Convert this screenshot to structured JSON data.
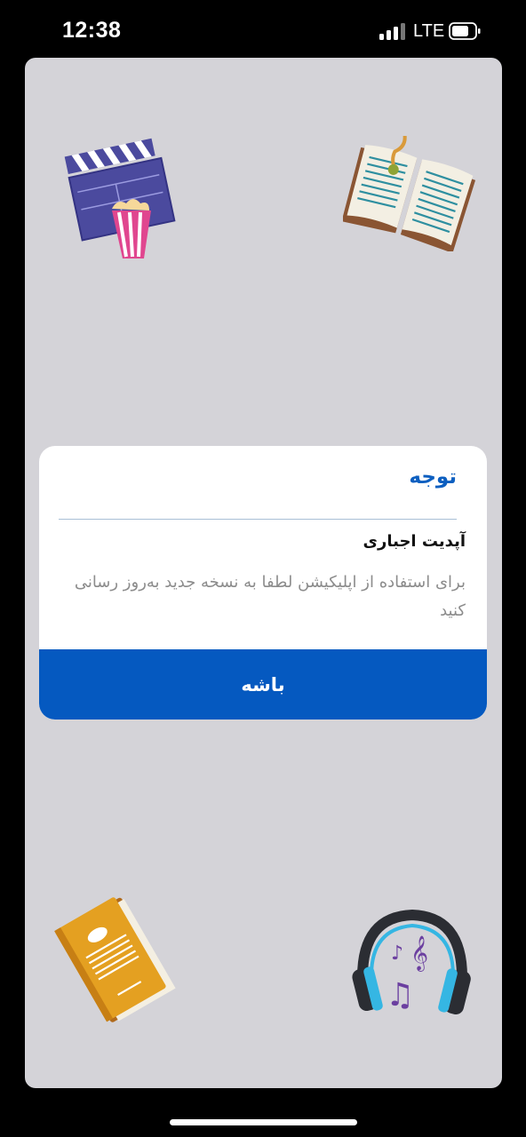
{
  "status_bar": {
    "time": "12:38",
    "network": "LTE"
  },
  "dialog": {
    "title": "توجه",
    "heading": "آپدیت اجباری",
    "message": "برای استفاده از اپلیکیشن لطفا به نسخه جدید به‌روز رسانی کنید",
    "button_label": "باشه"
  },
  "icons": {
    "cinema": "clapperboard-popcorn-icon",
    "open_book": "open-book-icon",
    "closed_book": "closed-book-icon",
    "music": "headphones-music-icon"
  },
  "colors": {
    "accent": "#0559c0",
    "title": "#0d5fc0",
    "background": "#d4d3d8",
    "message_text": "#8c8c8c"
  }
}
